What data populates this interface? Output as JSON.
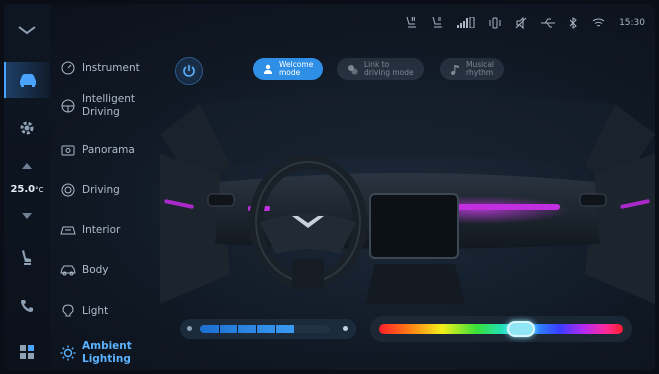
{
  "status_bar": {
    "time": "15:30",
    "icons": [
      "seat-heat-icon",
      "seat-vent-icon",
      "signal-icon",
      "vibrate-icon",
      "mute-icon",
      "usb-icon",
      "bluetooth-icon",
      "wifi-icon"
    ]
  },
  "rail": {
    "temperature": "25.0",
    "temperature_unit": "°C",
    "icons": [
      "collapse-chevron-icon",
      "car-icon",
      "settings-gear-icon",
      "temp-up-icon",
      "temp-down-icon",
      "seat-icon",
      "phone-icon",
      "apps-grid-icon"
    ]
  },
  "menu": {
    "items": [
      {
        "label": "Instrument",
        "icon": "gauge-icon"
      },
      {
        "label": "Intelligent Driving",
        "icon": "steering-wheel-icon"
      },
      {
        "label": "Panorama",
        "icon": "camera-icon"
      },
      {
        "label": "Driving",
        "icon": "drive-mode-icon"
      },
      {
        "label": "Interior",
        "icon": "interior-icon"
      },
      {
        "label": "Body",
        "icon": "car-body-icon"
      },
      {
        "label": "Light",
        "icon": "bulb-icon"
      },
      {
        "label": "Ambient Lighting",
        "icon": "ambient-light-icon",
        "active": true
      }
    ]
  },
  "controls": {
    "modes": [
      {
        "label_line1": "Welcome",
        "label_line2": "mode",
        "active": true
      },
      {
        "label_line1": "Link to",
        "label_line2": "driving mode",
        "active": false
      },
      {
        "label_line1": "Musical",
        "label_line2": "rhythm",
        "active": false
      }
    ]
  },
  "sliders": {
    "brightness_level": 0.72,
    "brightness_segments": 5,
    "color_hue_position": 0.58
  },
  "colors": {
    "accent": "#2f8fe6",
    "ambient_light": "#c22fe0"
  }
}
